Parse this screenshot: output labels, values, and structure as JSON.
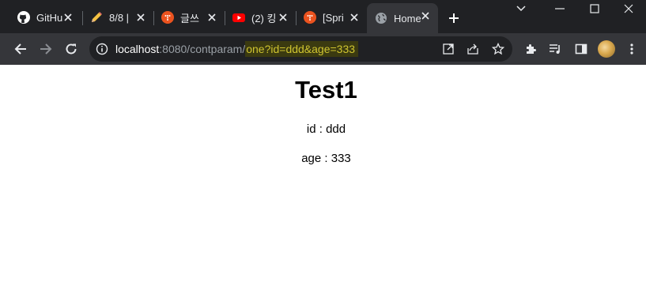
{
  "tabs": [
    {
      "title": "GitHub",
      "icon": "github-icon"
    },
    {
      "title": "8/8 |",
      "icon": "pencil-icon"
    },
    {
      "title": "글쓰",
      "icon": "tistory-icon"
    },
    {
      "title": "(2) 킹",
      "icon": "youtube-icon"
    },
    {
      "title": "[Spri",
      "icon": "tistory-icon"
    },
    {
      "title": "Home",
      "icon": "globe-icon"
    }
  ],
  "address": {
    "host": "localhost",
    "rest": ":8080/contparam/",
    "highlight": "one?id=ddd&age=333"
  },
  "page": {
    "title": "Test1",
    "id_line": "id : ddd",
    "age_line": "age : 333"
  }
}
